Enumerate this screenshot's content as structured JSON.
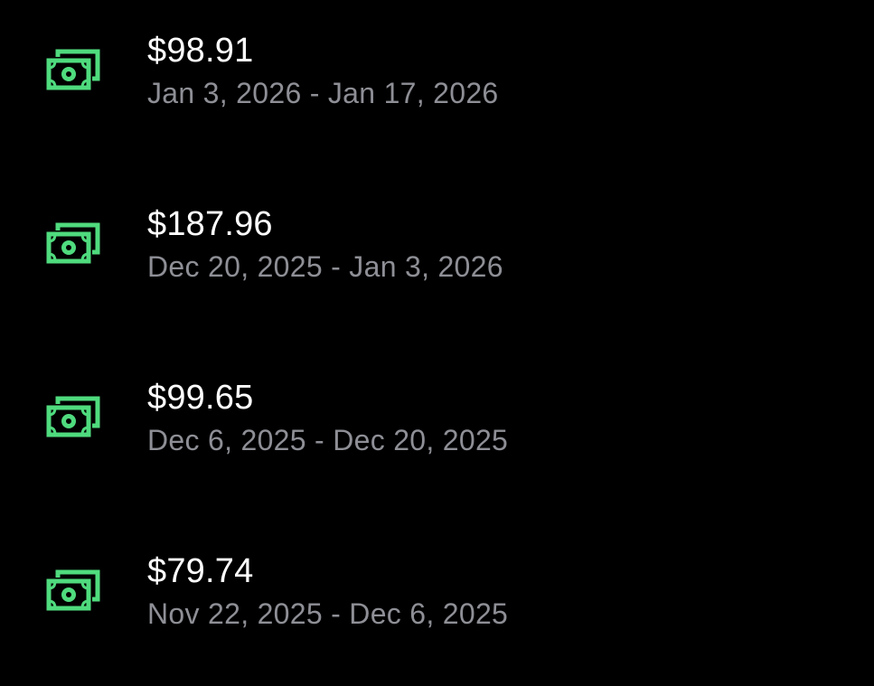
{
  "theme": {
    "background": "#000000",
    "accent": "#4fdb7e",
    "primary_text": "#ffffff",
    "secondary_text": "#8e8f96"
  },
  "payouts": [
    {
      "icon": "cash-icon",
      "amount": "$98.91",
      "period": "Jan 3, 2026 - Jan 17, 2026"
    },
    {
      "icon": "cash-icon",
      "amount": "$187.96",
      "period": "Dec 20, 2025 - Jan 3, 2026"
    },
    {
      "icon": "cash-icon",
      "amount": "$99.65",
      "period": "Dec 6, 2025 - Dec 20, 2025"
    },
    {
      "icon": "cash-icon",
      "amount": "$79.74",
      "period": "Nov 22, 2025 - Dec 6, 2025"
    }
  ]
}
